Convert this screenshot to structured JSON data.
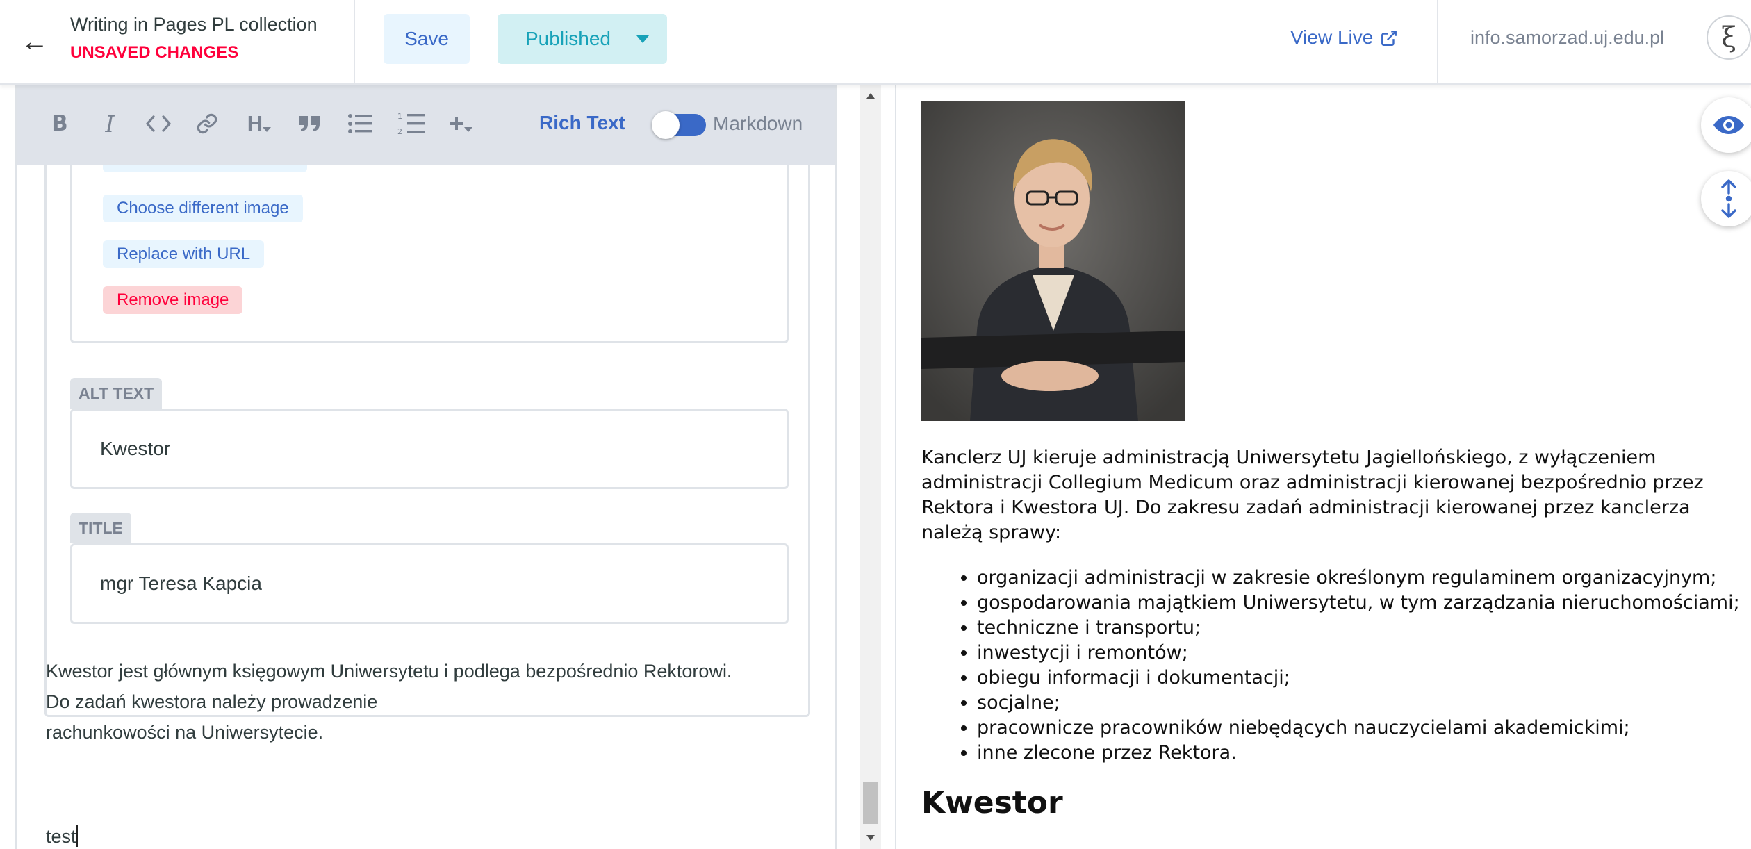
{
  "header": {
    "collection_title": "Writing in Pages PL collection",
    "unsaved_label": "UNSAVED CHANGES",
    "save_label": "Save",
    "published_label": "Published",
    "view_live_label": "View Live",
    "site_url": "info.samorzad.uj.edu.pl",
    "avatar_glyph": "ξ"
  },
  "toolbar": {
    "bold": "B",
    "italic": "I",
    "heading": "H",
    "rich_text_label": "Rich Text",
    "markdown_label": "Markdown",
    "rich_text_enabled": true
  },
  "image_widget": {
    "choose_label": "Choose different image",
    "replace_label": "Replace with URL",
    "remove_label": "Remove image"
  },
  "fields": {
    "alt_label": "ALT TEXT",
    "alt_value": "Kwestor",
    "title_label": "TITLE",
    "title_value": "mgr Teresa Kapcia"
  },
  "editor_body": {
    "line1": "Kwestor jest głównym księgowym Uniwersytetu i podlega bezpośrednio Rektorowi.",
    "line2": "Do zadań kwestora należy prowadzenie",
    "line3": "rachunkowości na Uniwersytecie.",
    "typed": "test"
  },
  "preview": {
    "paragraph_lines": [
      "Kanclerz UJ kieruje administracją Uniwersytetu Jagiellońskiego, z wyłączeniem",
      "administracji Collegium Medicum oraz administracji kierowanej bezpośrednio przez",
      "Rektora i Kwestora UJ. Do zakresu zadań administracji kierowanej przez kanclerza",
      "należą sprawy:"
    ],
    "list": [
      "organizacji administracji w zakresie określonym regulaminem organizacyjnym;",
      "gospodarowania majątkiem Uniwersytetu, w tym zarządzania nieruchomościami;",
      "techniczne i transportu;",
      "inwestycji i remontów;",
      "obiegu informacji i dokumentacji;",
      "socjalne;",
      "pracownicze pracowników niebędących nauczycielami akademickimi;",
      "inne zlecone przez Rektora."
    ],
    "heading": "Kwestor"
  },
  "colors": {
    "accent": "#3a69c7",
    "unsaved_red": "#ff003b",
    "published_teal": "#17a2b8",
    "toolbar_bg": "#dfe3ea"
  }
}
